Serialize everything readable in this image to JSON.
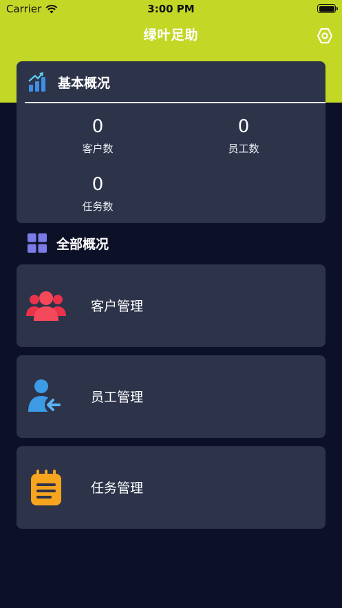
{
  "status_bar": {
    "carrier": "Carrier",
    "time": "3:00 PM"
  },
  "nav": {
    "title": "绿叶足助",
    "settings_icon": "settings-icon"
  },
  "overview": {
    "title": "基本概况",
    "icon": "bar-chart-icon",
    "stats": [
      {
        "value": "0",
        "label": "客户数"
      },
      {
        "value": "0",
        "label": "员工数"
      },
      {
        "value": "0",
        "label": "任务数"
      }
    ]
  },
  "all_overview": {
    "title": "全部概况",
    "icon": "grid-icon"
  },
  "menu": [
    {
      "label": "客户管理",
      "icon": "customers-icon"
    },
    {
      "label": "员工管理",
      "icon": "employee-icon"
    },
    {
      "label": "任务管理",
      "icon": "tasks-icon"
    }
  ],
  "colors": {
    "header": "#c3d826",
    "background": "#0d1127",
    "card": "#2d3349",
    "customers_icon": "#f4495a",
    "employee_icon": "#3d9be6",
    "tasks_icon": "#f7a41f",
    "grid_icon": "#7b7be8"
  }
}
